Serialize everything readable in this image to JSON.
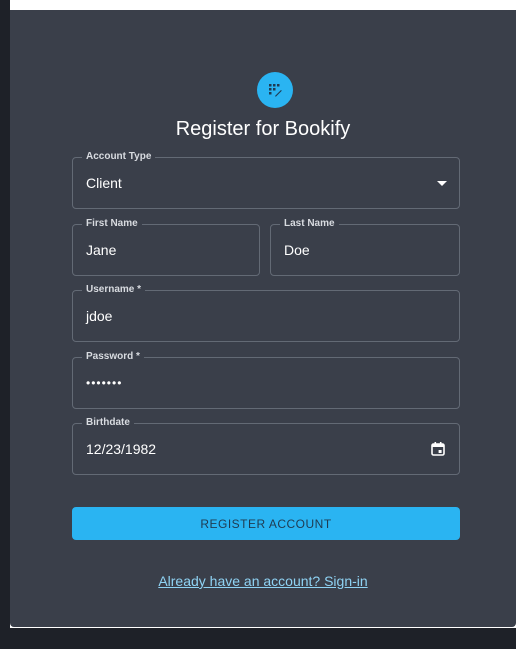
{
  "form": {
    "title": "Register for Bookify",
    "account_type": {
      "label": "Account Type",
      "value": "Client"
    },
    "first_name": {
      "label": "First Name",
      "value": "Jane"
    },
    "last_name": {
      "label": "Last Name",
      "value": "Doe"
    },
    "username": {
      "label": "Username *",
      "value": "jdoe"
    },
    "password": {
      "label": "Password *",
      "value": "•••••••"
    },
    "birthdate": {
      "label": "Birthdate",
      "value": "12/23/1982"
    },
    "register_label": "REGISTER ACCOUNT",
    "signin_link": "Already have an account? Sign-in"
  },
  "colors": {
    "accent": "#2ab4f2",
    "card_bg": "#3a3f4a",
    "link": "#8fd3f4"
  },
  "icons": {
    "logo": "grid-logo-icon",
    "dropdown": "chevron-down-icon",
    "date": "calendar-icon"
  }
}
